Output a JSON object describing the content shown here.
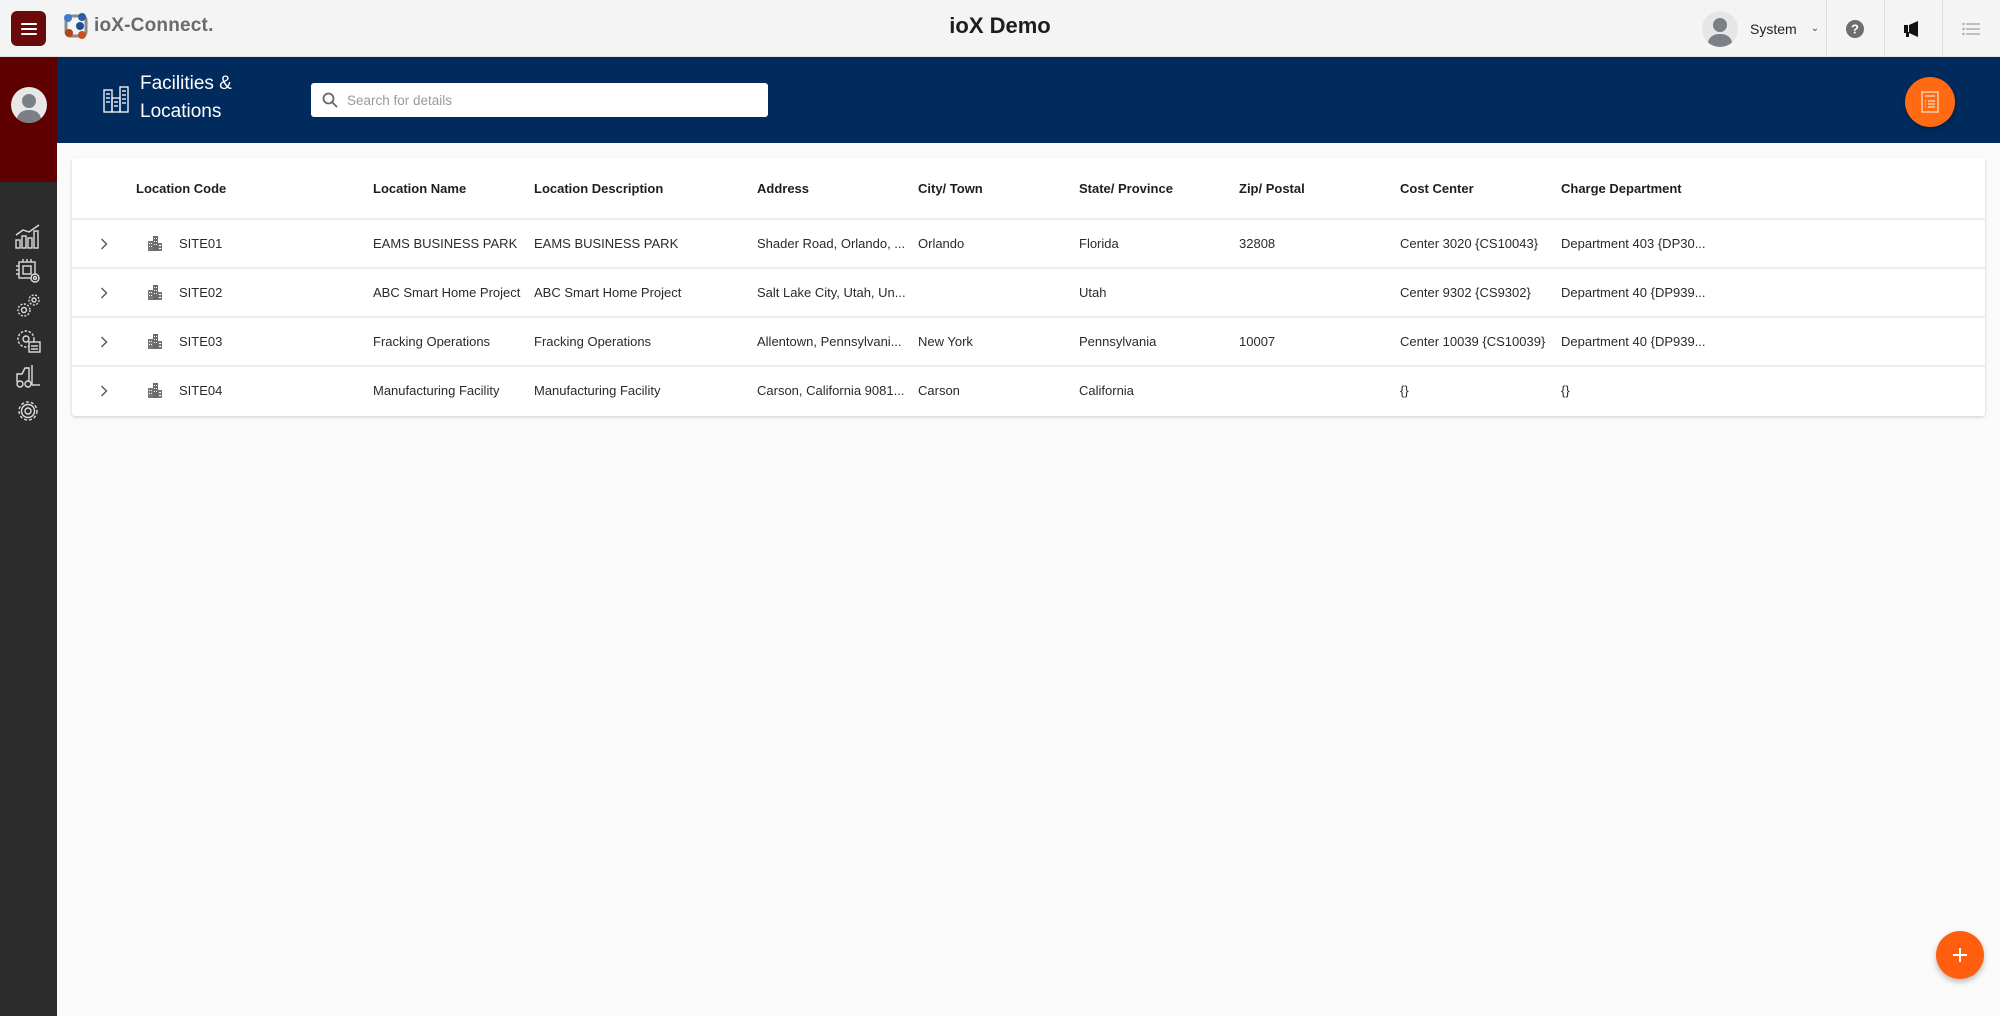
{
  "topbar": {
    "logo_text": "ioX-Connect.",
    "app_title": "ioX Demo",
    "user_name": "System",
    "icons": [
      "menu-icon",
      "help-icon",
      "megaphone-icon",
      "list-icon"
    ]
  },
  "sidebar": {
    "items": [
      {
        "name": "analytics",
        "icon": "bar-chart-icon"
      },
      {
        "name": "devices",
        "icon": "chip-gear-icon"
      },
      {
        "name": "configuration",
        "icon": "gears-icon"
      },
      {
        "name": "processes",
        "icon": "gear-form-icon"
      },
      {
        "name": "assets",
        "icon": "forklift-icon"
      },
      {
        "name": "settings",
        "icon": "gear-icon"
      }
    ]
  },
  "page": {
    "title": "Facilities & Locations",
    "search_placeholder": "Search for details",
    "search_value": ""
  },
  "table": {
    "columns": [
      "Location Code",
      "Location Name",
      "Location Description",
      "Address",
      "City/ Town",
      "State/ Province",
      "Zip/ Postal",
      "Cost Center",
      "Charge Department"
    ],
    "rows": [
      {
        "code": "SITE01",
        "name": "EAMS BUSINESS PARK",
        "description": "EAMS BUSINESS PARK",
        "address": "Shader Road, Orlando, ...",
        "city": "Orlando",
        "state": "Florida",
        "zip": "32808",
        "cost_center": "Center 3020 {CS10043}",
        "charge_department": "Department 403 {DP30..."
      },
      {
        "code": "SITE02",
        "name": "ABC Smart Home Project",
        "description": "ABC Smart Home Project",
        "address": "Salt Lake City, Utah, Un...",
        "city": "",
        "state": "Utah",
        "zip": "",
        "cost_center": "Center 9302 {CS9302}",
        "charge_department": "Department 40 {DP939..."
      },
      {
        "code": "SITE03",
        "name": "Fracking Operations",
        "description": "Fracking Operations",
        "address": "Allentown, Pennsylvani...",
        "city": "New York",
        "state": "Pennsylvania",
        "zip": "10007",
        "cost_center": "Center 10039 {CS10039}",
        "charge_department": "Department 40 {DP939..."
      },
      {
        "code": "SITE04",
        "name": "Manufacturing Facility",
        "description": "Manufacturing Facility",
        "address": "Carson, California 9081...",
        "city": "Carson",
        "state": "California",
        "zip": "",
        "cost_center": "{}",
        "charge_department": "{}"
      }
    ]
  },
  "colors": {
    "brand_maroon": "#5e0000",
    "header_navy": "#002b5c",
    "accent_orange": "#ff6a13",
    "sidebar_dark": "#2c2c2c"
  }
}
